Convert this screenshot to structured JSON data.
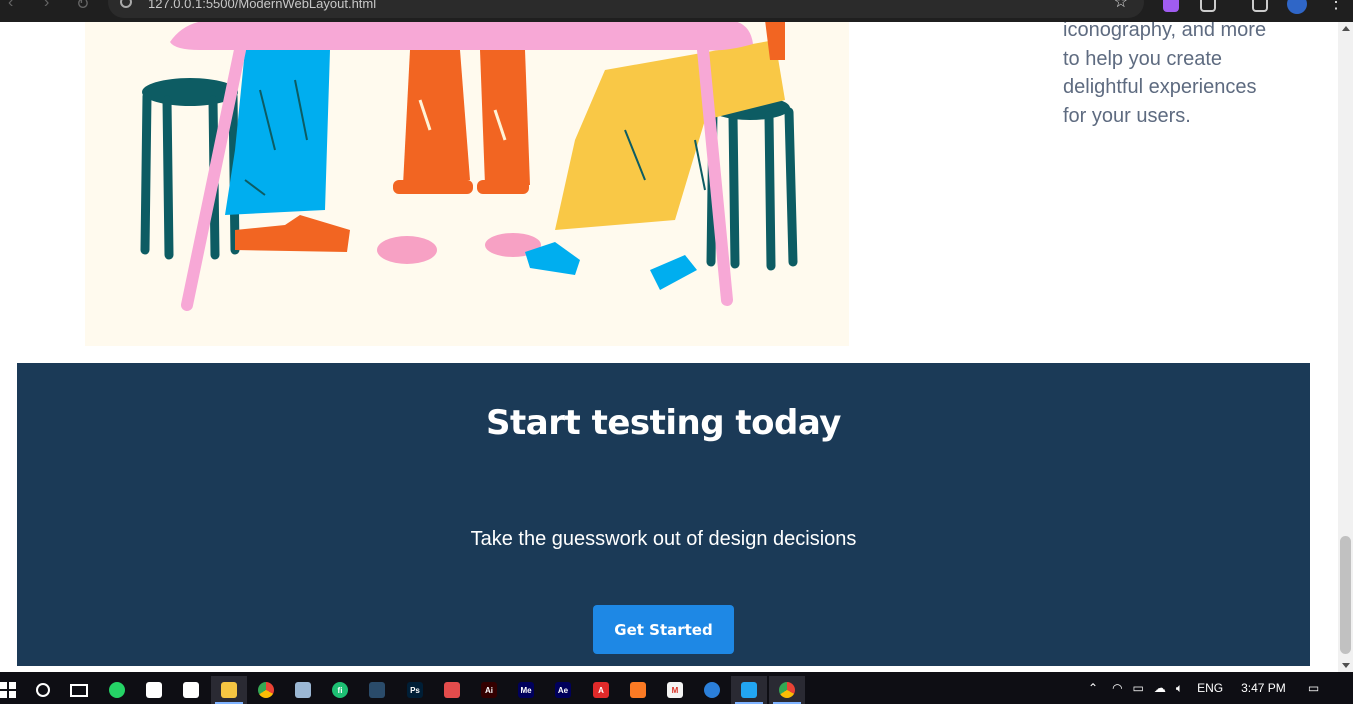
{
  "browser": {
    "url": "127.0.0.1:5500/ModernWebLayout.html",
    "star_icon": "star-icon",
    "menu_icon": "more-vert-icon"
  },
  "page": {
    "side_text": "iconography, and more to help you create delightful experiences for your users.",
    "cta": {
      "title": "Start testing today",
      "subtitle": "Take the guesswork out of design decisions",
      "button_label": "Get Started",
      "background_color": "#1b3a57",
      "button_color": "#1e88e5"
    }
  },
  "taskbar": {
    "apps": [
      {
        "name": "whatsapp",
        "color": "#25d366",
        "label": ""
      },
      {
        "name": "store",
        "color": "#ffffff",
        "label": ""
      },
      {
        "name": "mail",
        "color": "#ffffff",
        "label": ""
      },
      {
        "name": "file-explorer",
        "color": "#f5c542",
        "label": ""
      },
      {
        "name": "chrome",
        "color": "#ea4335",
        "label": ""
      },
      {
        "name": "paint",
        "color": "#9bb7d4",
        "label": ""
      },
      {
        "name": "fiverr",
        "color": "#1dbf73",
        "label": "fi"
      },
      {
        "name": "terminal",
        "color": "#2a4b6a",
        "label": ""
      },
      {
        "name": "photoshop",
        "color": "#001e36",
        "label": "Ps"
      },
      {
        "name": "media-player",
        "color": "#e34c4c",
        "label": ""
      },
      {
        "name": "illustrator",
        "color": "#330000",
        "label": "Ai"
      },
      {
        "name": "media-encoder",
        "color": "#00005b",
        "label": "Me"
      },
      {
        "name": "after-effects",
        "color": "#00005b",
        "label": "Ae"
      },
      {
        "name": "acrobat",
        "color": "#e02a2a",
        "label": "A"
      },
      {
        "name": "xampp",
        "color": "#fb7a24",
        "label": ""
      },
      {
        "name": "gmail",
        "color": "#f4f4f4",
        "label": "M"
      },
      {
        "name": "edge",
        "color": "#2b7fd9",
        "label": ""
      },
      {
        "name": "vscode",
        "color": "#22a6f2",
        "label": ""
      },
      {
        "name": "chrome-active",
        "color": "#ea4335",
        "label": ""
      }
    ],
    "tray": {
      "language": "ENG",
      "time": "3:47 PM"
    }
  }
}
